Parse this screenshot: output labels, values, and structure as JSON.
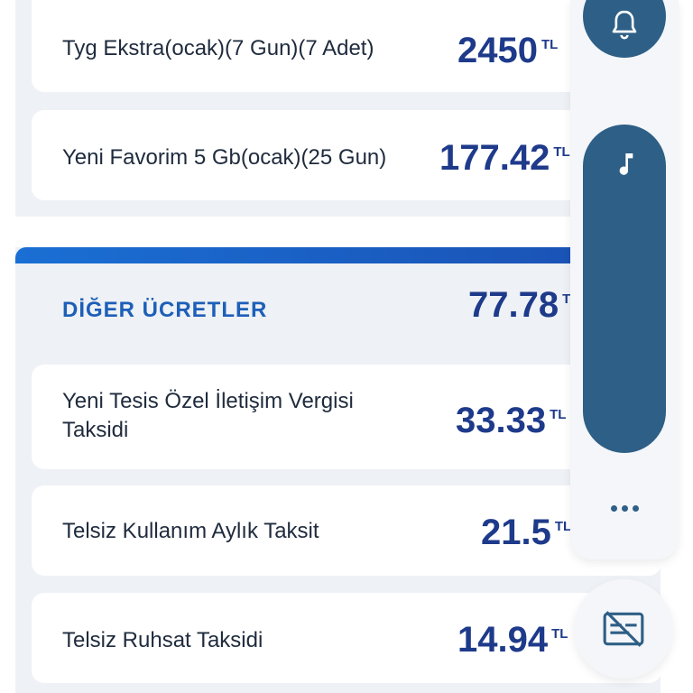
{
  "currency": "TL",
  "colors": {
    "amount": "#1e3a8a",
    "section_title": "#1d5fb8",
    "accent_bar": "#1a6fd4",
    "side_button": "#2e5f86"
  },
  "packages": [
    {
      "label": "Tyg Ekstra(ocak)(7 Gun)(7 Adet)",
      "amount": "2450"
    },
    {
      "label": "Yeni Favorim 5 Gb(ocak)(25 Gun)",
      "amount": "177.42"
    }
  ],
  "other_fees": {
    "title": "DİĞER ÜCRETLER",
    "total": "77.78",
    "total_currency": "T",
    "items": [
      {
        "label_line1": "Yeni Tesis Özel İletişim Vergisi",
        "label_line2": "Taksidi",
        "amount": "33.33"
      },
      {
        "label": "Telsiz Kullanım Aylık Taksit",
        "amount": "21.5"
      },
      {
        "label": "Telsiz Ruhsat Taksidi",
        "amount": "14.94"
      }
    ]
  },
  "side_panel": {
    "bell_icon": "bell-icon",
    "music_icon": "music-note-icon",
    "more_icon": "more-dots-icon",
    "caption_icon": "captions-off-icon"
  }
}
